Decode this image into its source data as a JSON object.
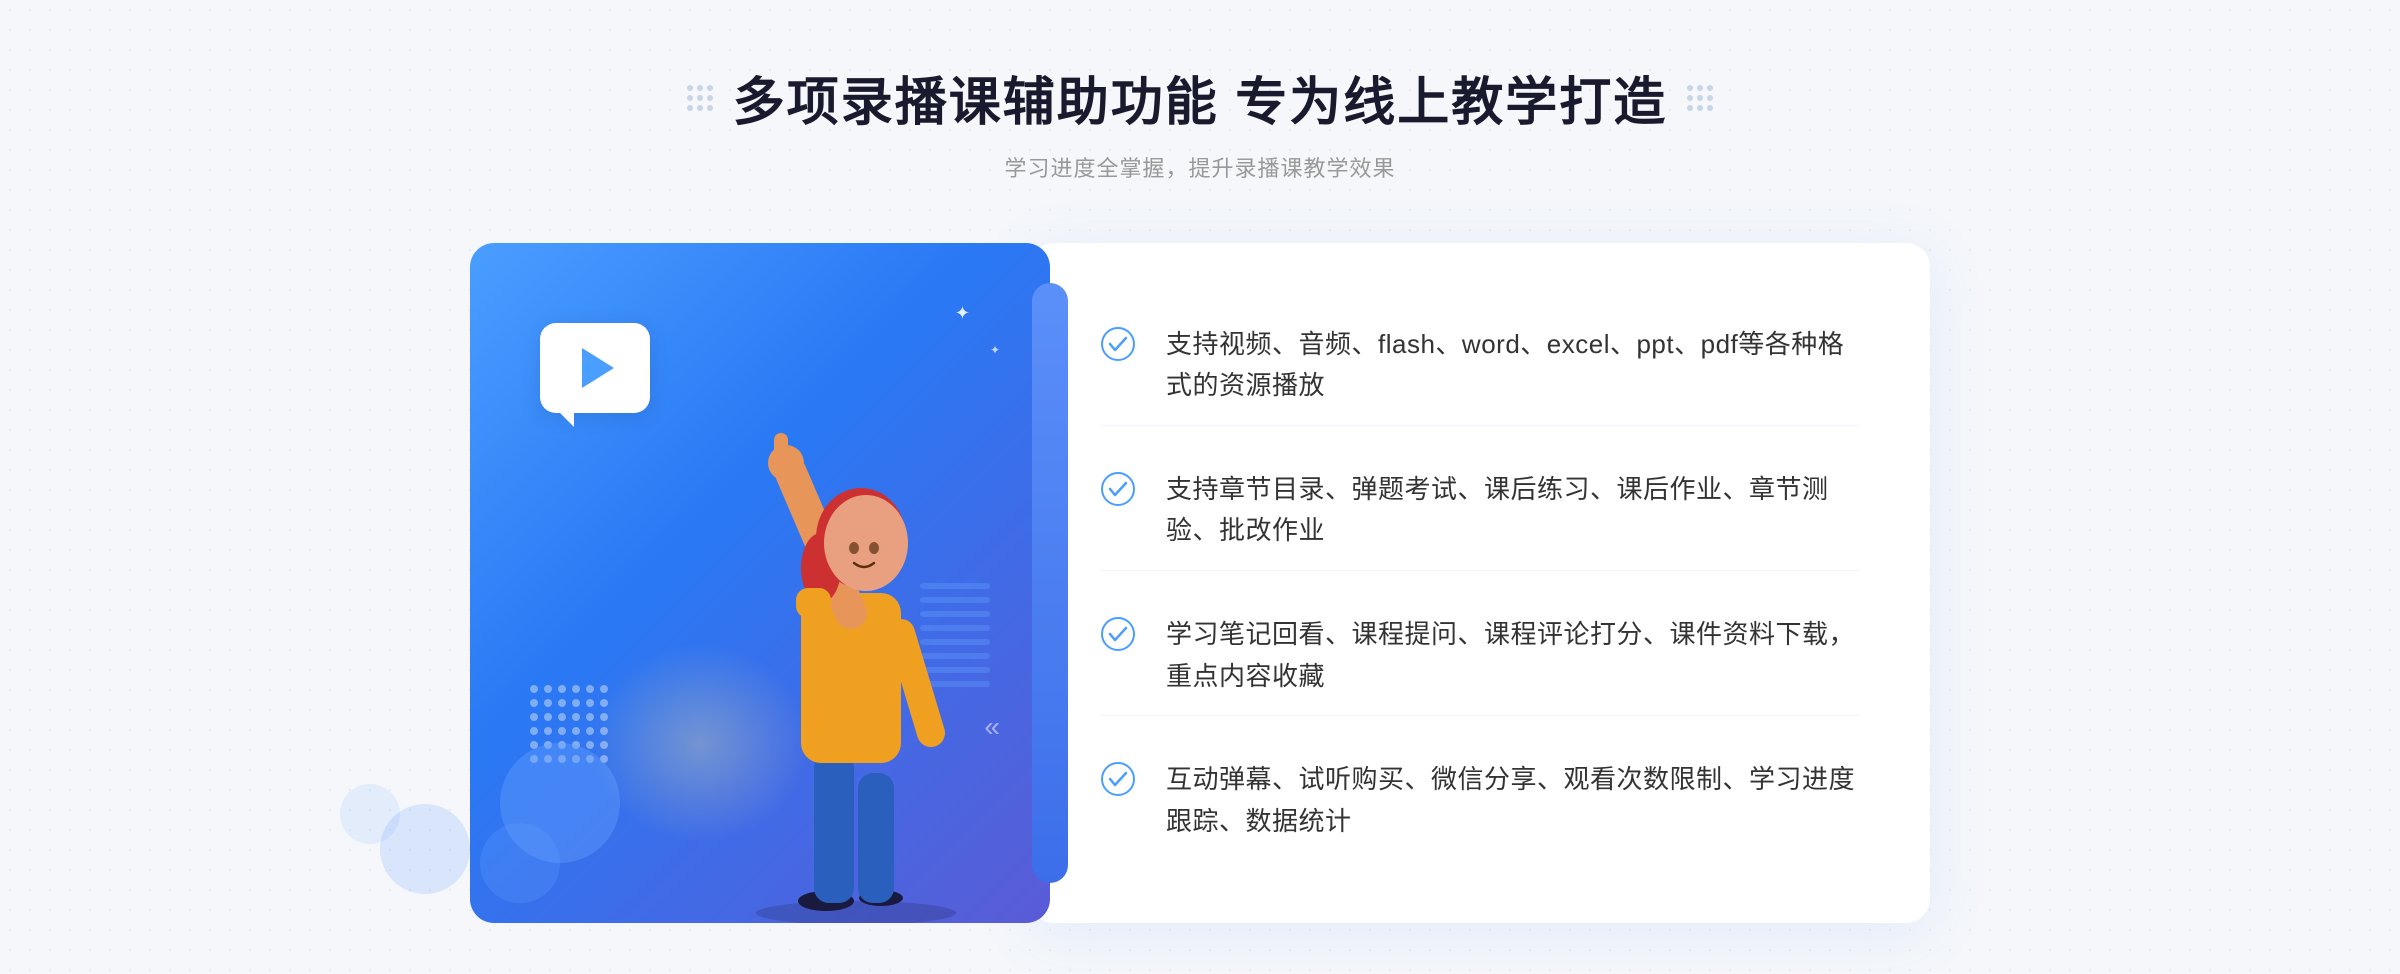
{
  "header": {
    "title": "多项录播课辅助功能 专为线上教学打造",
    "subtitle": "学习进度全掌握，提升录播课教学效果"
  },
  "features": [
    {
      "id": 1,
      "text": "支持视频、音频、flash、word、excel、ppt、pdf等各种格式的资源播放"
    },
    {
      "id": 2,
      "text": "支持章节目录、弹题考试、课后练习、课后作业、章节测验、批改作业"
    },
    {
      "id": 3,
      "text": "学习笔记回看、课程提问、课程评论打分、课件资料下载，重点内容收藏"
    },
    {
      "id": 4,
      "text": "互动弹幕、试听购买、微信分享、观看次数限制、学习进度跟踪、数据统计"
    }
  ],
  "decorations": {
    "left_arrow": "»",
    "dots_label": "decorative-dots"
  }
}
